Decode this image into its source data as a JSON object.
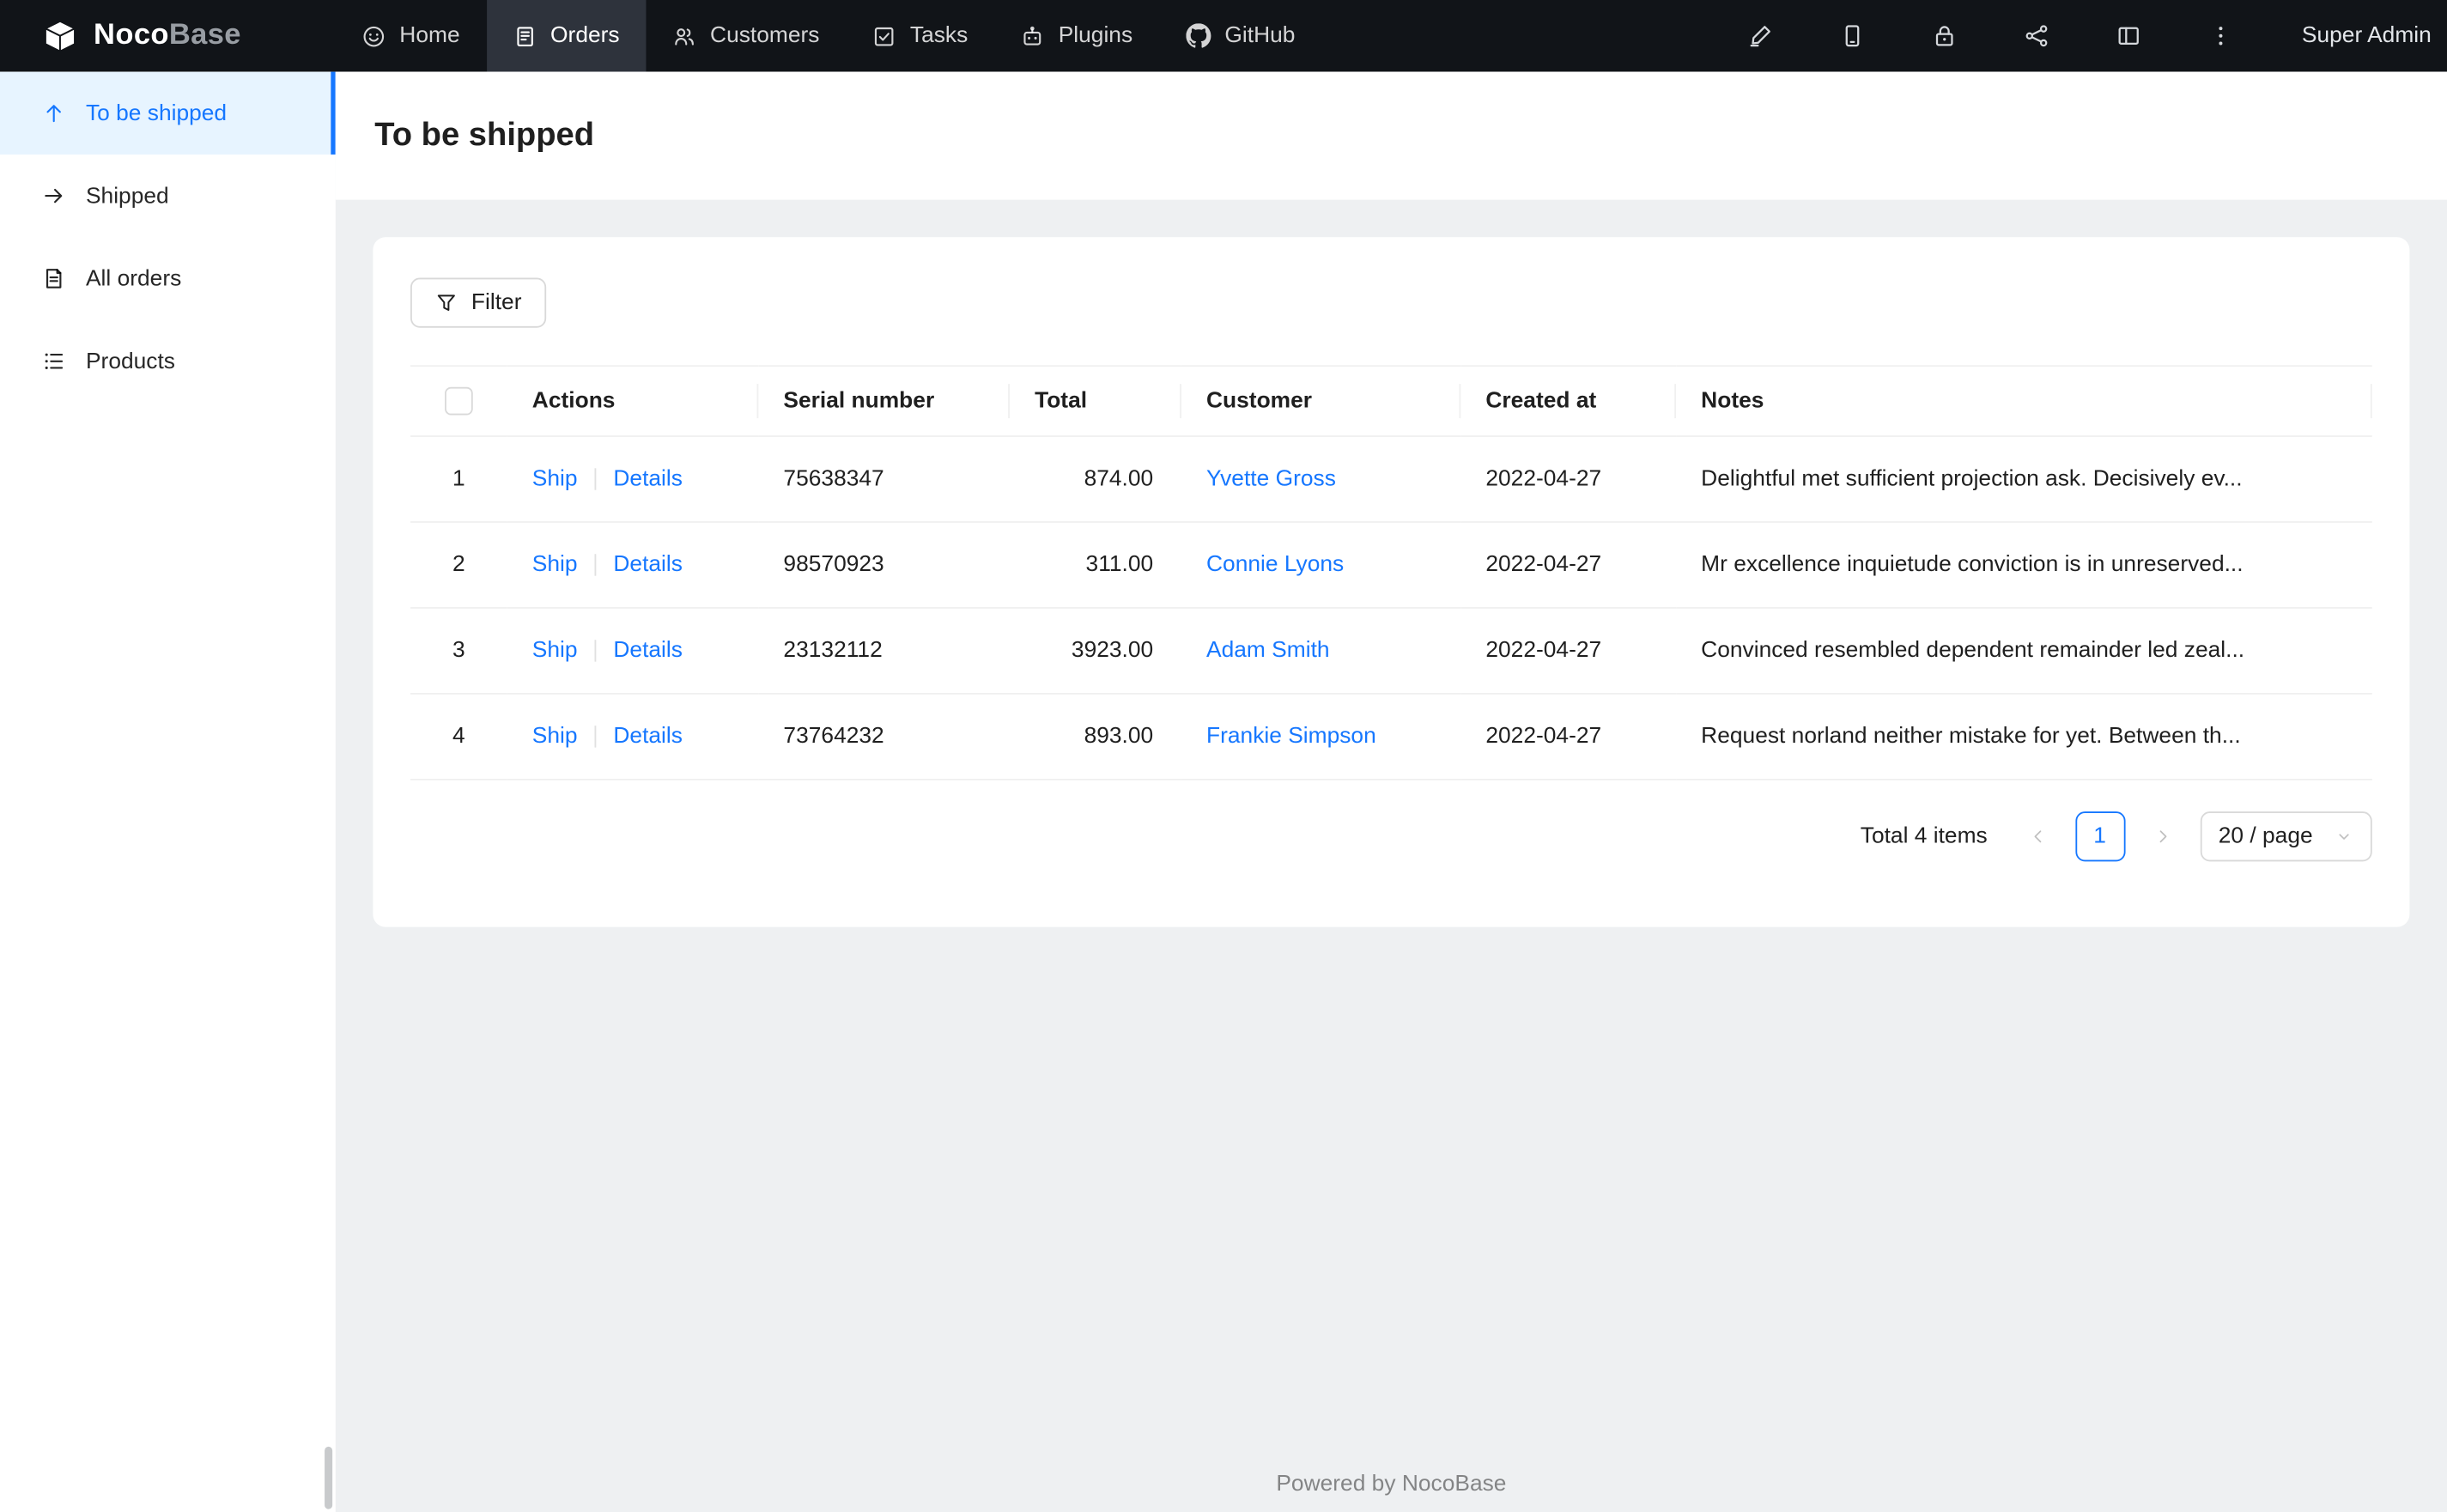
{
  "header": {
    "logo": {
      "bold": "Noco",
      "light": "Base"
    },
    "nav": [
      {
        "label": "Home",
        "icon": "smile-icon",
        "active": false
      },
      {
        "label": "Orders",
        "icon": "clipboard-icon",
        "active": true
      },
      {
        "label": "Customers",
        "icon": "team-icon",
        "active": false
      },
      {
        "label": "Tasks",
        "icon": "check-square-icon",
        "active": false
      },
      {
        "label": "Plugins",
        "icon": "robot-icon",
        "active": false
      },
      {
        "label": "GitHub",
        "icon": "github-icon",
        "active": false
      }
    ],
    "action_icons": [
      "highlighter-icon",
      "mobile-icon",
      "lock-icon",
      "share-icon",
      "layout-icon",
      "more-icon"
    ],
    "user": "Super Admin"
  },
  "sidebar": {
    "items": [
      {
        "label": "To be shipped",
        "icon": "arrow-up-icon",
        "active": true
      },
      {
        "label": "Shipped",
        "icon": "arrow-right-icon",
        "active": false
      },
      {
        "label": "All orders",
        "icon": "document-icon",
        "active": false
      },
      {
        "label": "Products",
        "icon": "list-icon",
        "active": false
      }
    ]
  },
  "page": {
    "title": "To be shipped"
  },
  "toolbar": {
    "filter_label": "Filter"
  },
  "table": {
    "columns": {
      "actions": "Actions",
      "serial": "Serial number",
      "total": "Total",
      "customer": "Customer",
      "created": "Created at",
      "notes": "Notes"
    },
    "rows": [
      {
        "index": "1",
        "ship": "Ship",
        "details": "Details",
        "serial": "75638347",
        "total": "874.00",
        "customer": "Yvette Gross",
        "created": "2022-04-27",
        "notes": "Delightful met sufficient projection ask. Decisively ev..."
      },
      {
        "index": "2",
        "ship": "Ship",
        "details": "Details",
        "serial": "98570923",
        "total": "311.00",
        "customer": "Connie Lyons",
        "created": "2022-04-27",
        "notes": "Mr excellence inquietude conviction is in unreserved..."
      },
      {
        "index": "3",
        "ship": "Ship",
        "details": "Details",
        "serial": "23132112",
        "total": "3923.00",
        "customer": "Adam Smith",
        "created": "2022-04-27",
        "notes": "Convinced resembled dependent remainder led zeal..."
      },
      {
        "index": "4",
        "ship": "Ship",
        "details": "Details",
        "serial": "73764232",
        "total": "893.00",
        "customer": "Frankie Simpson",
        "created": "2022-04-27",
        "notes": "Request norland neither mistake for yet. Between th..."
      }
    ]
  },
  "pagination": {
    "total_text": "Total 4 items",
    "current_page": "1",
    "page_size": "20 / page"
  },
  "footer": {
    "text": "Powered by NocoBase"
  },
  "colors": {
    "accent": "#1677ff",
    "header_bg": "#111418",
    "active_nav_bg": "#2e333c",
    "sidebar_active_bg": "#e7f4ff",
    "content_bg": "#eef0f2"
  }
}
